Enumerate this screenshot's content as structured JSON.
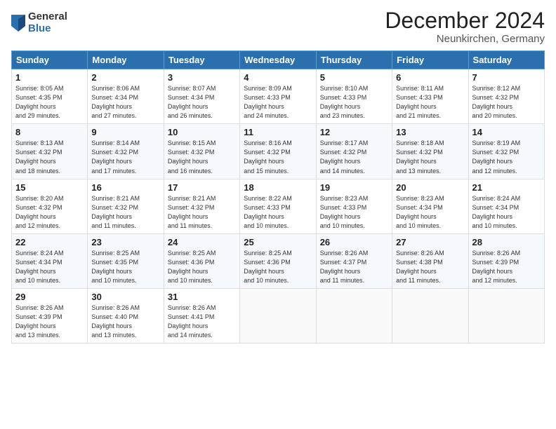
{
  "header": {
    "logo_general": "General",
    "logo_blue": "Blue",
    "month_title": "December 2024",
    "location": "Neunkirchen, Germany"
  },
  "days_of_week": [
    "Sunday",
    "Monday",
    "Tuesday",
    "Wednesday",
    "Thursday",
    "Friday",
    "Saturday"
  ],
  "weeks": [
    [
      {
        "day": 1,
        "sunrise": "8:05 AM",
        "sunset": "4:35 PM",
        "daylight": "8 hours and 29 minutes."
      },
      {
        "day": 2,
        "sunrise": "8:06 AM",
        "sunset": "4:34 PM",
        "daylight": "8 hours and 27 minutes."
      },
      {
        "day": 3,
        "sunrise": "8:07 AM",
        "sunset": "4:34 PM",
        "daylight": "8 hours and 26 minutes."
      },
      {
        "day": 4,
        "sunrise": "8:09 AM",
        "sunset": "4:33 PM",
        "daylight": "8 hours and 24 minutes."
      },
      {
        "day": 5,
        "sunrise": "8:10 AM",
        "sunset": "4:33 PM",
        "daylight": "8 hours and 23 minutes."
      },
      {
        "day": 6,
        "sunrise": "8:11 AM",
        "sunset": "4:33 PM",
        "daylight": "8 hours and 21 minutes."
      },
      {
        "day": 7,
        "sunrise": "8:12 AM",
        "sunset": "4:32 PM",
        "daylight": "8 hours and 20 minutes."
      }
    ],
    [
      {
        "day": 8,
        "sunrise": "8:13 AM",
        "sunset": "4:32 PM",
        "daylight": "8 hours and 18 minutes."
      },
      {
        "day": 9,
        "sunrise": "8:14 AM",
        "sunset": "4:32 PM",
        "daylight": "8 hours and 17 minutes."
      },
      {
        "day": 10,
        "sunrise": "8:15 AM",
        "sunset": "4:32 PM",
        "daylight": "8 hours and 16 minutes."
      },
      {
        "day": 11,
        "sunrise": "8:16 AM",
        "sunset": "4:32 PM",
        "daylight": "8 hours and 15 minutes."
      },
      {
        "day": 12,
        "sunrise": "8:17 AM",
        "sunset": "4:32 PM",
        "daylight": "8 hours and 14 minutes."
      },
      {
        "day": 13,
        "sunrise": "8:18 AM",
        "sunset": "4:32 PM",
        "daylight": "8 hours and 13 minutes."
      },
      {
        "day": 14,
        "sunrise": "8:19 AM",
        "sunset": "4:32 PM",
        "daylight": "8 hours and 12 minutes."
      }
    ],
    [
      {
        "day": 15,
        "sunrise": "8:20 AM",
        "sunset": "4:32 PM",
        "daylight": "8 hours and 12 minutes."
      },
      {
        "day": 16,
        "sunrise": "8:21 AM",
        "sunset": "4:32 PM",
        "daylight": "8 hours and 11 minutes."
      },
      {
        "day": 17,
        "sunrise": "8:21 AM",
        "sunset": "4:32 PM",
        "daylight": "8 hours and 11 minutes."
      },
      {
        "day": 18,
        "sunrise": "8:22 AM",
        "sunset": "4:33 PM",
        "daylight": "8 hours and 10 minutes."
      },
      {
        "day": 19,
        "sunrise": "8:23 AM",
        "sunset": "4:33 PM",
        "daylight": "8 hours and 10 minutes."
      },
      {
        "day": 20,
        "sunrise": "8:23 AM",
        "sunset": "4:34 PM",
        "daylight": "8 hours and 10 minutes."
      },
      {
        "day": 21,
        "sunrise": "8:24 AM",
        "sunset": "4:34 PM",
        "daylight": "8 hours and 10 minutes."
      }
    ],
    [
      {
        "day": 22,
        "sunrise": "8:24 AM",
        "sunset": "4:34 PM",
        "daylight": "8 hours and 10 minutes."
      },
      {
        "day": 23,
        "sunrise": "8:25 AM",
        "sunset": "4:35 PM",
        "daylight": "8 hours and 10 minutes."
      },
      {
        "day": 24,
        "sunrise": "8:25 AM",
        "sunset": "4:36 PM",
        "daylight": "8 hours and 10 minutes."
      },
      {
        "day": 25,
        "sunrise": "8:25 AM",
        "sunset": "4:36 PM",
        "daylight": "8 hours and 10 minutes."
      },
      {
        "day": 26,
        "sunrise": "8:26 AM",
        "sunset": "4:37 PM",
        "daylight": "8 hours and 11 minutes."
      },
      {
        "day": 27,
        "sunrise": "8:26 AM",
        "sunset": "4:38 PM",
        "daylight": "8 hours and 11 minutes."
      },
      {
        "day": 28,
        "sunrise": "8:26 AM",
        "sunset": "4:39 PM",
        "daylight": "8 hours and 12 minutes."
      }
    ],
    [
      {
        "day": 29,
        "sunrise": "8:26 AM",
        "sunset": "4:39 PM",
        "daylight": "8 hours and 13 minutes."
      },
      {
        "day": 30,
        "sunrise": "8:26 AM",
        "sunset": "4:40 PM",
        "daylight": "8 hours and 13 minutes."
      },
      {
        "day": 31,
        "sunrise": "8:26 AM",
        "sunset": "4:41 PM",
        "daylight": "8 hours and 14 minutes."
      },
      null,
      null,
      null,
      null
    ]
  ]
}
